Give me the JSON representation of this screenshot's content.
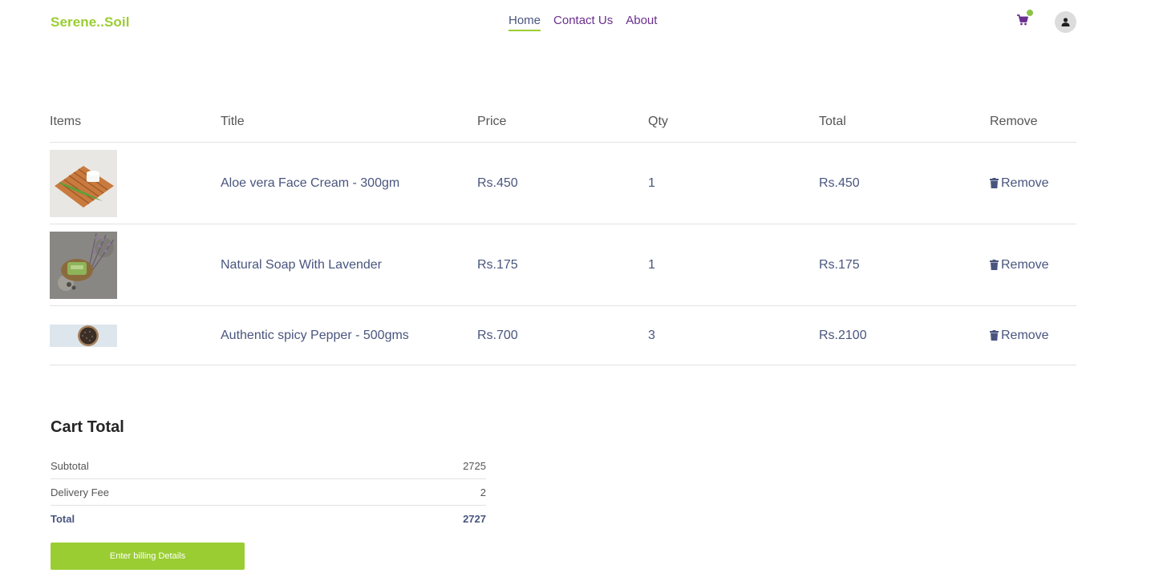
{
  "navbar": {
    "logo": "Serene..Soil",
    "menu": [
      "Home",
      "Contact Us",
      "About"
    ],
    "active": "Home"
  },
  "cart": {
    "headers": [
      "Items",
      "Title",
      "Price",
      "Qty",
      "Total",
      "Remove"
    ],
    "items": [
      {
        "title": "Aloe vera Face Cream - 300gm",
        "price": "Rs.450",
        "qty": "1",
        "total": "Rs.450",
        "remove": "Remove"
      },
      {
        "title": "Natural Soap With Lavender",
        "price": "Rs.175",
        "qty": "1",
        "total": "Rs.175",
        "remove": "Remove"
      },
      {
        "title": "Authentic spicy Pepper - 500gms",
        "price": "Rs.700",
        "qty": "3",
        "total": "Rs.2100",
        "remove": "Remove"
      }
    ]
  },
  "cart_total": {
    "heading": "Cart Total",
    "subtotal_label": "Subtotal",
    "subtotal": "2725",
    "delivery_label": "Delivery Fee",
    "delivery": "2",
    "total_label": "Total",
    "total": "2727",
    "button": "Enter billing Details"
  },
  "colors": {
    "accent": "#9acd32",
    "text": "#49557e",
    "nav_purple": "#6b2f8f"
  }
}
